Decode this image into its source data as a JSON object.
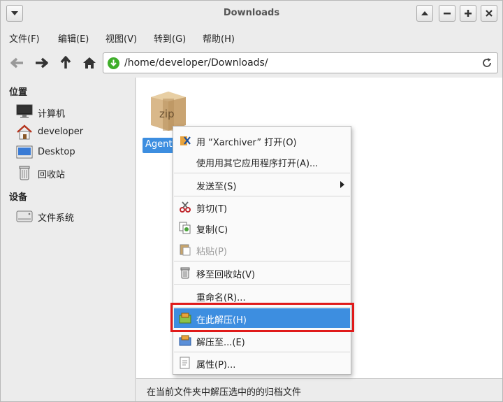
{
  "window": {
    "title": "Downloads"
  },
  "menubar": {
    "items": [
      "文件(F)",
      "编辑(E)",
      "视图(V)",
      "转到(G)",
      "帮助(H)"
    ]
  },
  "toolbar": {
    "location_path": "/home/developer/Downloads/"
  },
  "sidebar": {
    "places_heading": "位置",
    "places": [
      {
        "label": "计算机",
        "icon": "computer-icon"
      },
      {
        "label": "developer",
        "icon": "home-icon"
      },
      {
        "label": "Desktop",
        "icon": "desktop-icon"
      },
      {
        "label": "回收站",
        "icon": "trash-icon"
      }
    ],
    "devices_heading": "设备",
    "devices": [
      {
        "label": "文件系统",
        "icon": "drive-icon"
      }
    ]
  },
  "main": {
    "file_icon_text": "zip",
    "file_name": "Agent."
  },
  "context_menu": {
    "items": [
      {
        "label": "用 “Xarchiver” 打开(O)",
        "icon": "xarchiver-icon"
      },
      {
        "label": "使用用其它应用程序打开(A)...",
        "icon": ""
      },
      {
        "label": "发送至(S)",
        "icon": "",
        "submenu": true
      },
      {
        "label": "剪切(T)",
        "icon": "scissors-icon"
      },
      {
        "label": "复制(C)",
        "icon": "copy-icon"
      },
      {
        "label": "粘贴(P)",
        "icon": "paste-icon",
        "disabled": true
      },
      {
        "label": "移至回收站(V)",
        "icon": "trash-icon"
      },
      {
        "label": "重命名(R)...",
        "icon": ""
      },
      {
        "label": "在此解压(H)",
        "icon": "extract-icon",
        "active": true
      },
      {
        "label": "解压至...(E)",
        "icon": "extract-to-icon"
      },
      {
        "label": "属性(P)...",
        "icon": "properties-icon"
      }
    ]
  },
  "statusbar": {
    "text": "在当前文件夹中解压选中的的归档文件"
  },
  "colors": {
    "selection": "#3d8ee0",
    "highlight_box": "#e01a1a"
  }
}
